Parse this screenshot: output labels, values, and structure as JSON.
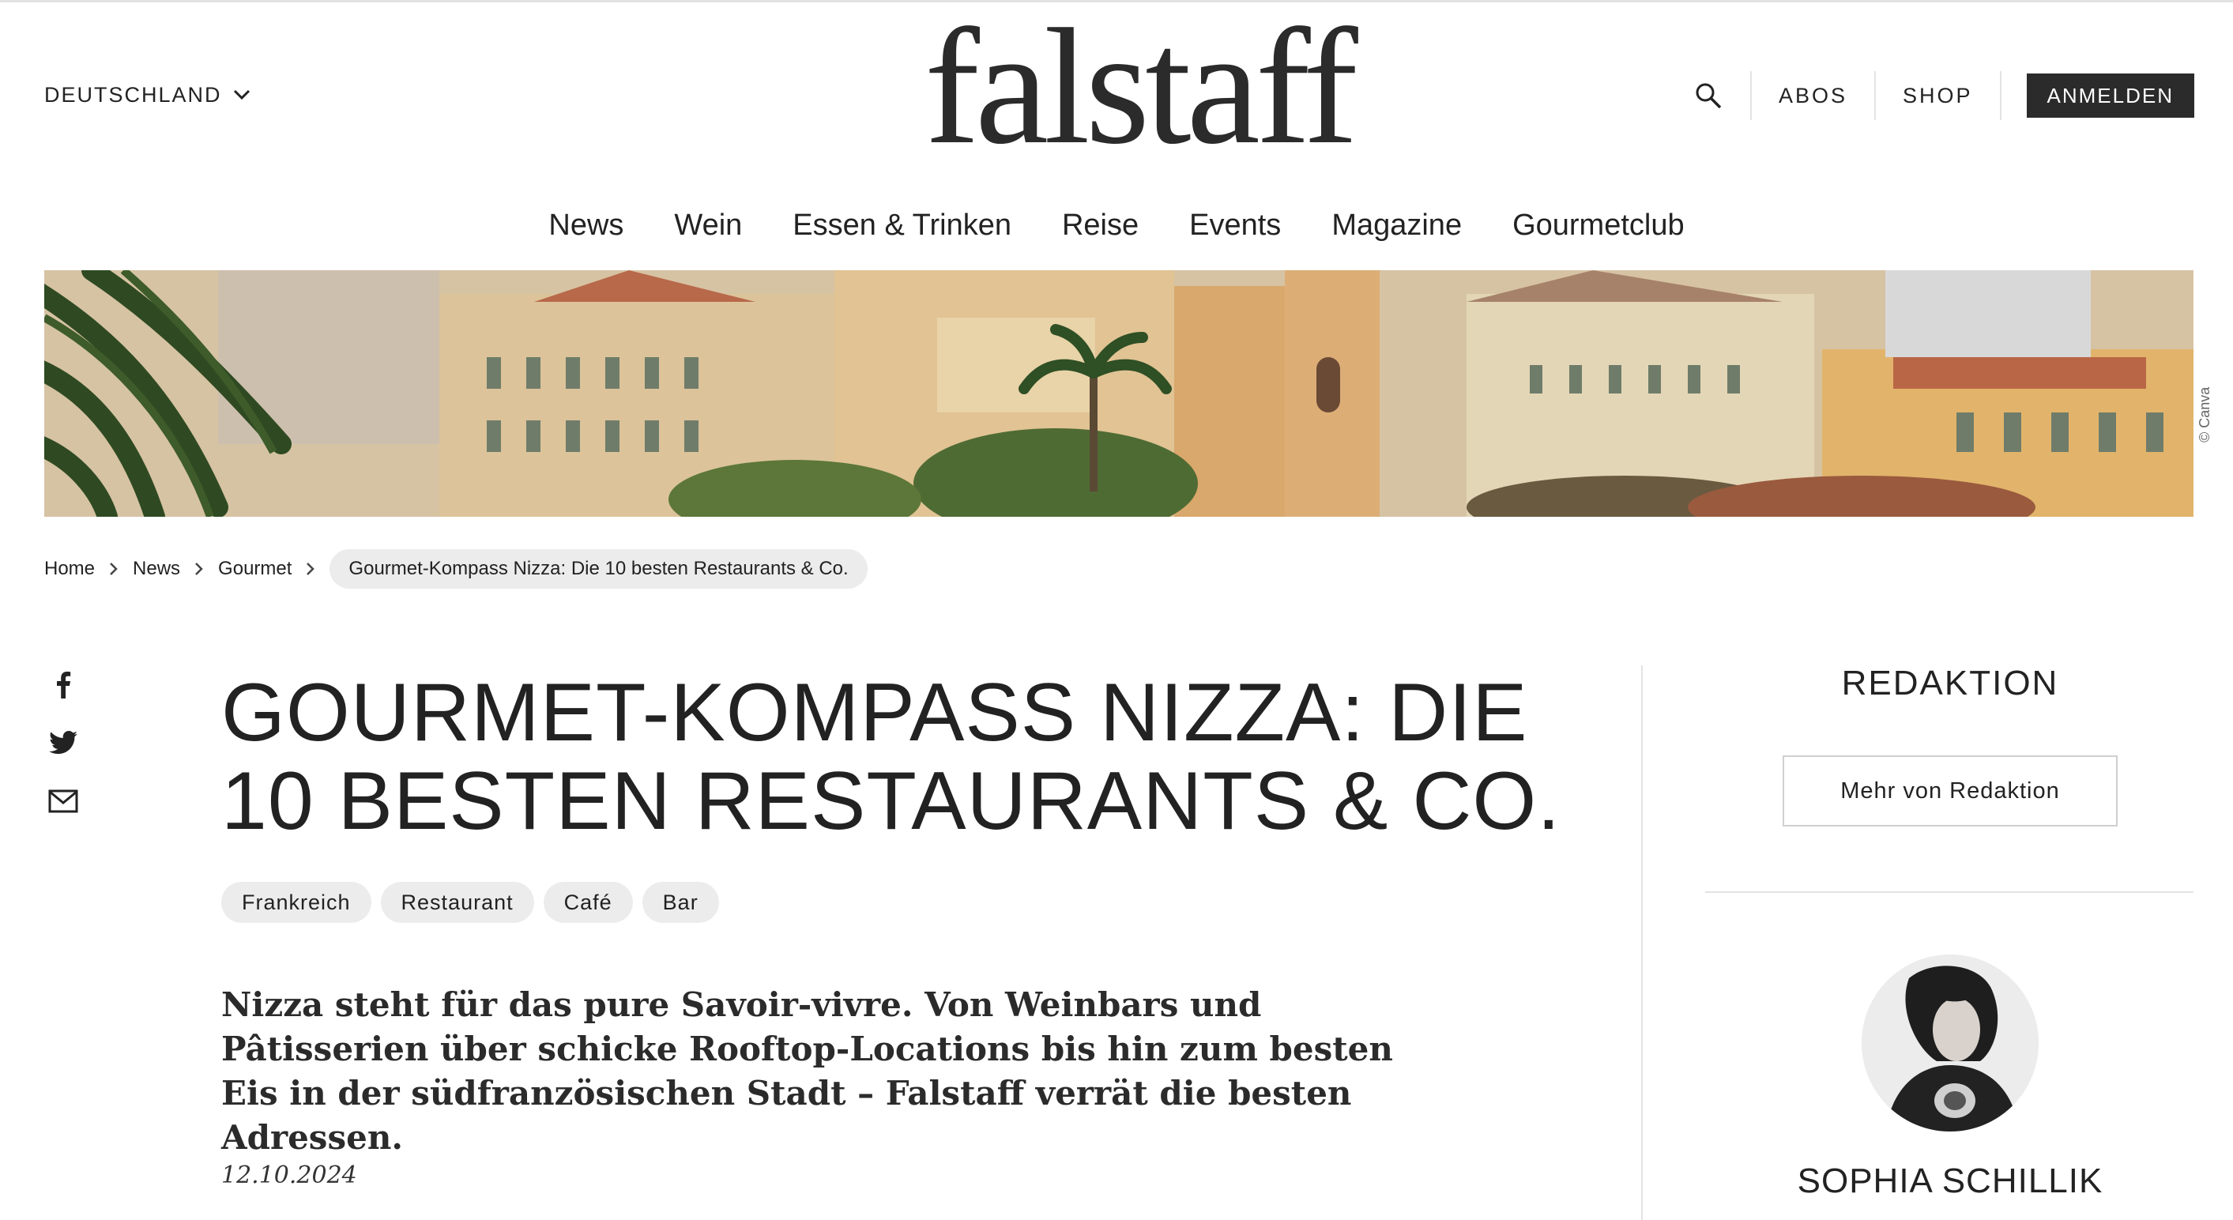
{
  "header": {
    "country": "DEUTSCHLAND",
    "logo_text": "falstaff",
    "links": [
      "ABOS",
      "SHOP"
    ],
    "login": "ANMELDEN"
  },
  "nav": [
    "News",
    "Wein",
    "Essen & Trinken",
    "Reise",
    "Events",
    "Magazine",
    "Gourmetclub"
  ],
  "hero": {
    "credit": "© Canva"
  },
  "breadcrumb": {
    "items": [
      "Home",
      "News",
      "Gourmet"
    ],
    "current": "Gourmet-Kompass Nizza: Die 10 besten Restaurants & Co."
  },
  "article": {
    "title": "GOURMET-KOMPASS NIZZA: DIE 10 BESTEN RESTAURANTS & CO.",
    "tags": [
      "Frankreich",
      "Restaurant",
      "Café",
      "Bar"
    ],
    "lead": "Nizza steht für das pure Savoir-vivre. Von Weinbars und Pâtisserien über schicke Rooftop-Locations bis hin zum besten Eis in der südfranzösischen Stadt – Falstaff verrät die besten Adressen.",
    "date": "12.10.2024"
  },
  "sidebar": {
    "heading": "REDAKTION",
    "button": "Mehr von Redaktion",
    "author": "SOPHIA SCHILLIK"
  },
  "colors": {
    "text": "#222222",
    "pill": "#ececec",
    "button_dark": "#2b2b2b",
    "divider": "#e3e3e3"
  }
}
